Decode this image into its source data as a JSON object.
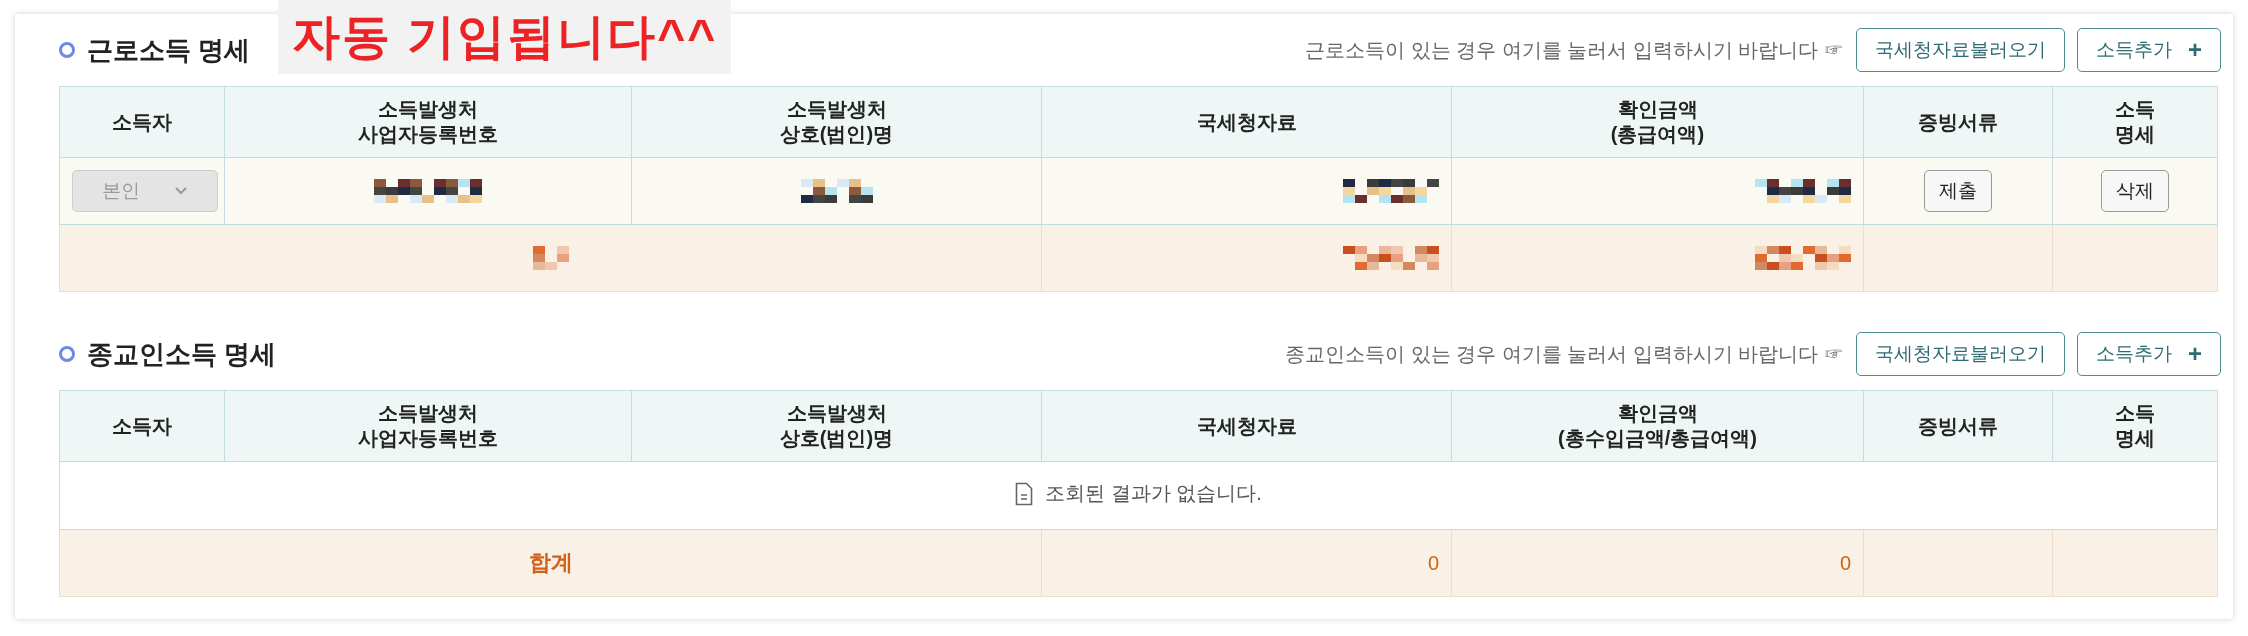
{
  "annotation": "자동 기입됩니다^^",
  "sections": [
    {
      "title": "근로소득 명세",
      "hint": "근로소득이 있는 경우 여기를 눌러서 입력하시기 바랍니다 ☞",
      "buttons": [
        {
          "kind": "load",
          "label": "국세청자료불러오기"
        },
        {
          "kind": "add",
          "label": "소득추가",
          "icon": "+"
        }
      ],
      "columns": [
        "소득자",
        "소득발생처\n사업자등록번호",
        "소득발생처\n상호(법인)명",
        "국세청자료",
        "확인금액\n(총급여액)",
        "증빙서류",
        "소득\n명세"
      ],
      "rows": [
        [
          {
            "kind": "select",
            "value": "본인",
            "disabled": true
          },
          {
            "kind": "redacted"
          },
          {
            "kind": "redacted"
          },
          {
            "kind": "redacted"
          },
          {
            "kind": "redacted"
          },
          {
            "kind": "button",
            "label": "제출"
          },
          {
            "kind": "button",
            "label": "삭제"
          }
        ]
      ],
      "total": [
        {
          "kind": "redacted"
        },
        {
          "kind": "redacted"
        },
        {
          "kind": "redacted"
        }
      ]
    },
    {
      "title": "종교인소득 명세",
      "hint": "종교인소득이 있는 경우 여기를 눌러서 입력하시기 바랍니다 ☞",
      "buttons": [
        {
          "kind": "load",
          "label": "국세청자료불러오기"
        },
        {
          "kind": "add",
          "label": "소득추가",
          "icon": "+"
        }
      ],
      "columns": [
        "소득자",
        "소득발생처\n사업자등록번호",
        "소득발생처\n상호(법인)명",
        "국세청자료",
        "확인금액\n(총수입금액/총급여액)",
        "증빙서류",
        "소득\n명세"
      ],
      "empty_message": "조회된 결과가 없습니다.",
      "total": [
        {
          "kind": "text",
          "text": "합계"
        },
        {
          "kind": "text",
          "text": "0"
        },
        {
          "kind": "text",
          "text": "0"
        }
      ]
    }
  ]
}
